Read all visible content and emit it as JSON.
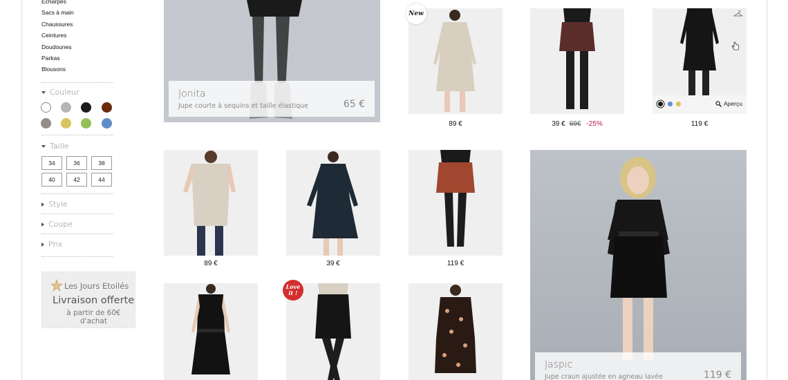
{
  "sidebar": {
    "categories": [
      "Echarpes",
      "Sacs à main",
      "Chaussures",
      "Ceintures",
      "Doudounes",
      "Parkas",
      "Blousons"
    ],
    "facets": {
      "couleur": "Couleur",
      "taille": "Taille",
      "style": "Style",
      "coupe": "Coupe",
      "prix": "Prix"
    },
    "colors": [
      "#ffffff",
      "#b5b5b5",
      "#1c1c1c",
      "#6b2a0c",
      "#938c85",
      "#d9c45e",
      "#93bf56",
      "#5e8dca"
    ],
    "sizes": [
      "34",
      "36",
      "38",
      "40",
      "42",
      "44"
    ],
    "promo": {
      "line1": "Les Jours Etoilés",
      "line2": "Livraison offerte",
      "line3": "à partir de 60€ d'achat"
    }
  },
  "featured": [
    {
      "name": "Jonita",
      "desc": "Jupe courte à sequins et taille élastique",
      "price": "65 €"
    },
    {
      "name": "Jaspic",
      "desc": "Jupe craun ajustée en agneau lavée",
      "price": "119 €"
    }
  ],
  "products": {
    "p1": {
      "price": "89 €",
      "badge": "New"
    },
    "p2": {
      "price": "39 €",
      "old_price": "69€",
      "discount": "-25%"
    },
    "p3": {
      "price": "119 €",
      "quick_view": "Aperçu",
      "variant_colors": [
        "#111111",
        "#5e8dca",
        "#d9c45e"
      ]
    },
    "p4": {
      "price": "89 €"
    },
    "p5": {
      "price": "39 €"
    },
    "p6": {
      "price": "119 €"
    },
    "p7": {},
    "p8": {
      "badge": "Love it !"
    },
    "p9": {}
  }
}
